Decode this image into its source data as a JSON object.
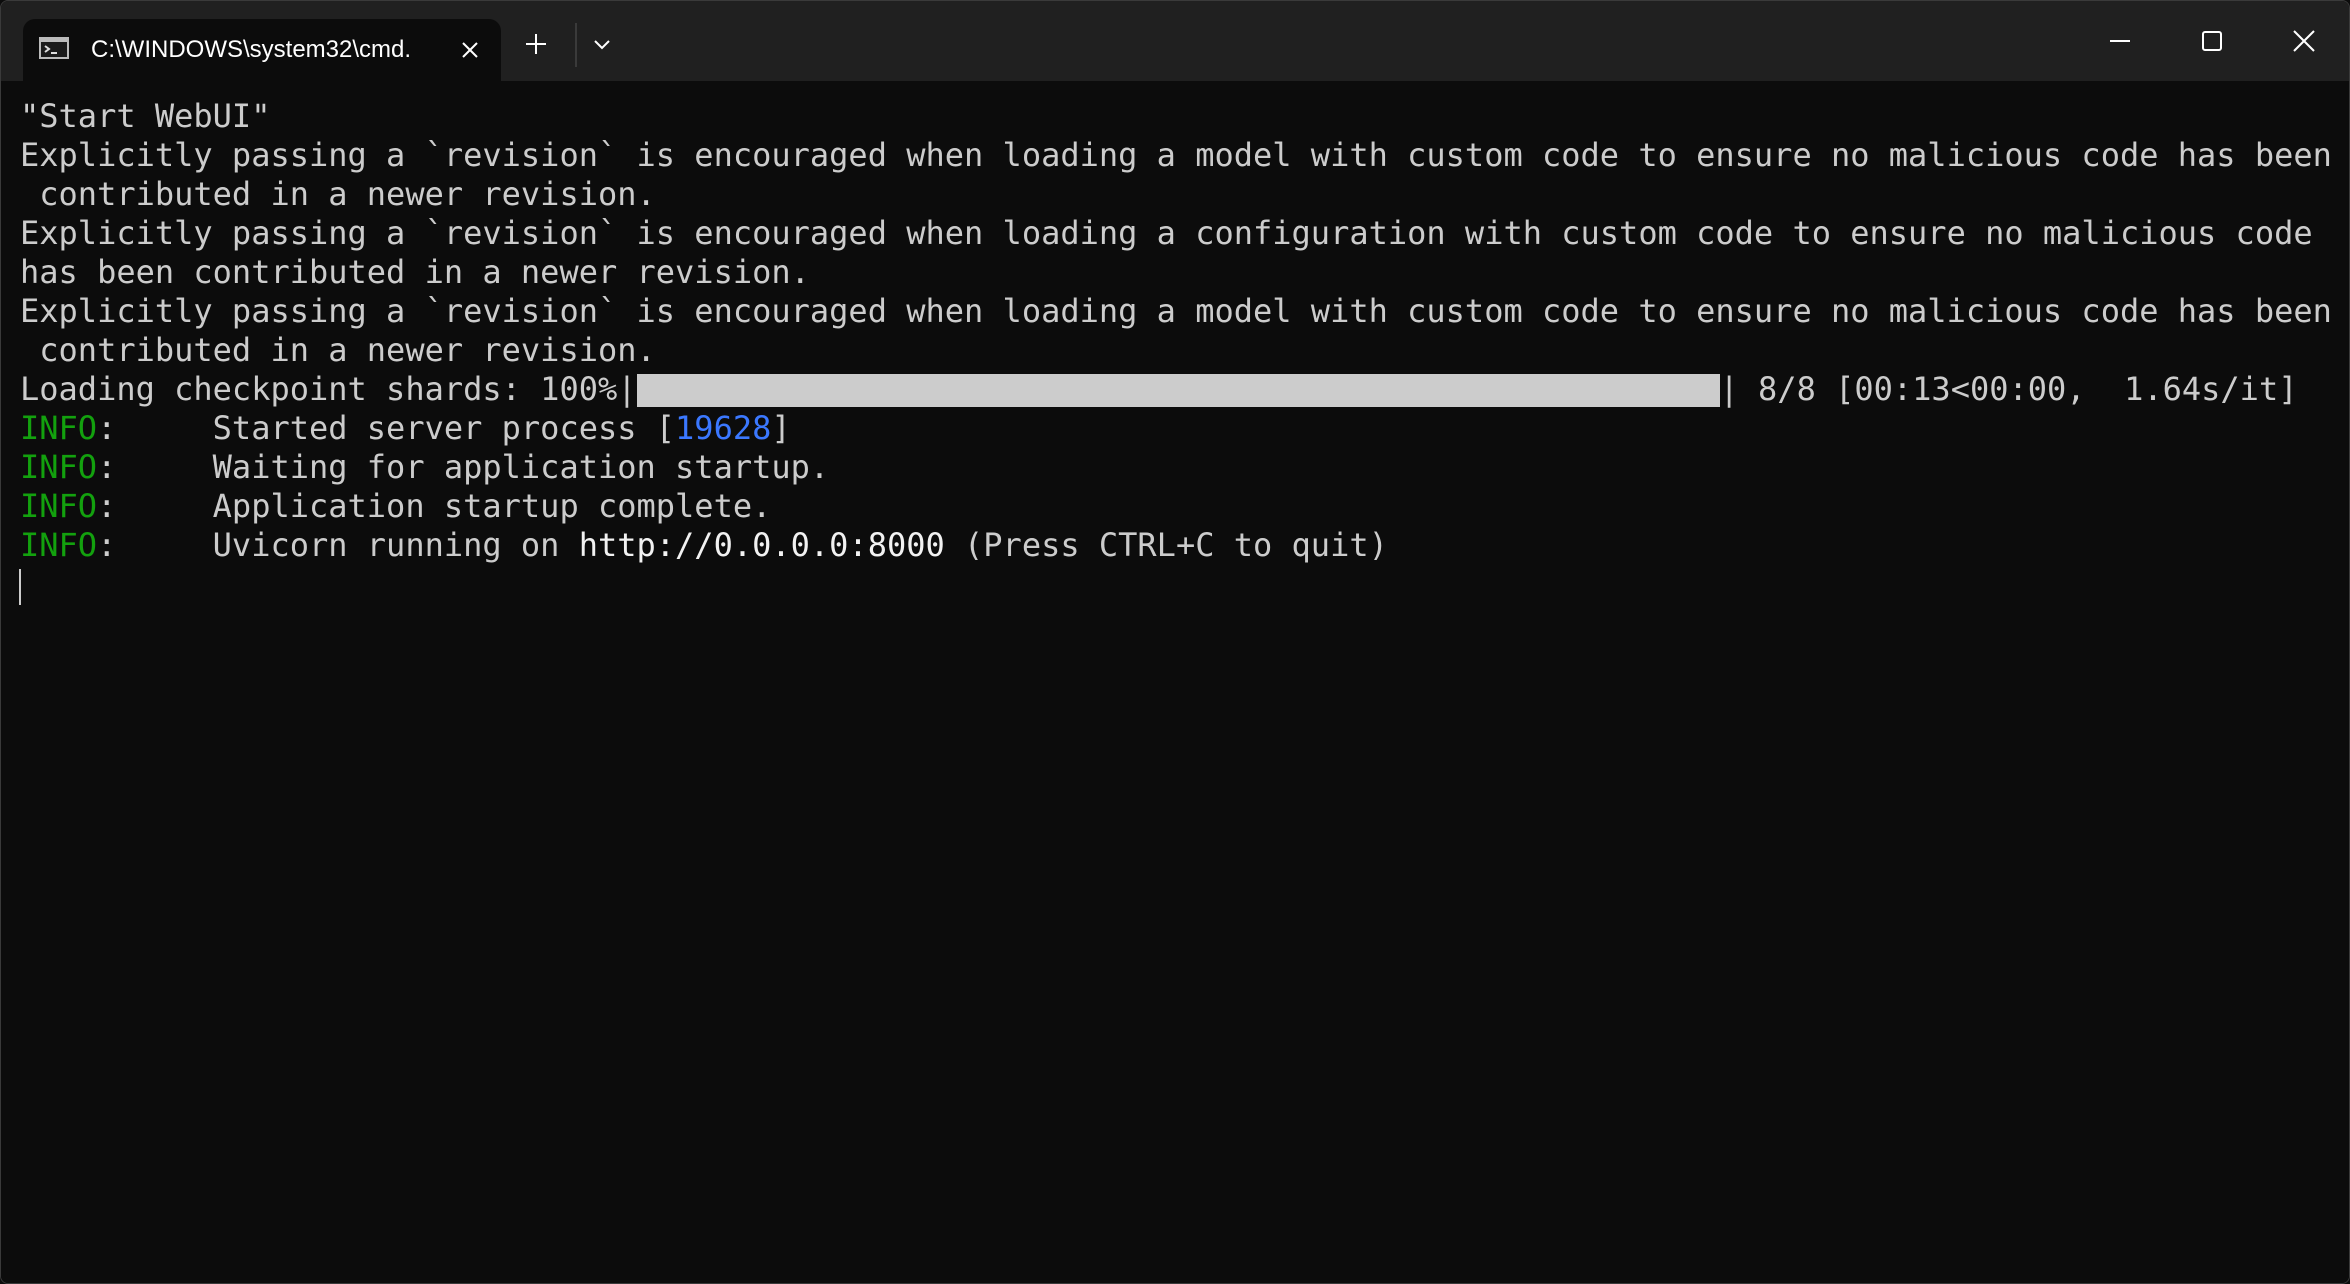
{
  "window": {
    "tab_title": "C:\\WINDOWS\\system32\\cmd.",
    "tab_icon": "cmd-icon",
    "tab_close_icon": "close-icon",
    "new_tab_icon": "plus-icon",
    "dropdown_icon": "chevron-down-icon",
    "controls": [
      "minimize-icon",
      "maximize-icon",
      "close-icon"
    ]
  },
  "terminal": {
    "line0": "\"Start WebUI\"",
    "line1": "Explicitly passing a `revision` is encouraged when loading a model with custom code to ensure no malicious code has been",
    "line2": " contributed in a newer revision.",
    "line3": "Explicitly passing a `revision` is encouraged when loading a configuration with custom code to ensure no malicious code",
    "line4": "has been contributed in a newer revision.",
    "line5": "Explicitly passing a `revision` is encouraged when loading a model with custom code to ensure no malicious code has been",
    "line6": " contributed in a newer revision.",
    "progress": {
      "prefix": "Loading checkpoint shards: 100%|",
      "suffix": "| 8/8 [00:13<00:00,  1.64s/it]",
      "fraction": 1.0
    },
    "info": {
      "label": "INFO",
      "colon": ":",
      "l1_pre": "     Started server process [",
      "l1_pid": "19628",
      "l1_post": "]",
      "l2": "     Waiting for application startup.",
      "l3": "     Application startup complete.",
      "l4_pre": "     Uvicorn running on ",
      "l4_url": "http://0.0.0.0:8000",
      "l4_post": " (Press CTRL+C to quit)"
    }
  },
  "colors": {
    "background": "#0c0c0c",
    "titlebar": "#202020",
    "text": "#cccccc",
    "info_green": "#13a10e",
    "pid_blue": "#3b78ff"
  }
}
